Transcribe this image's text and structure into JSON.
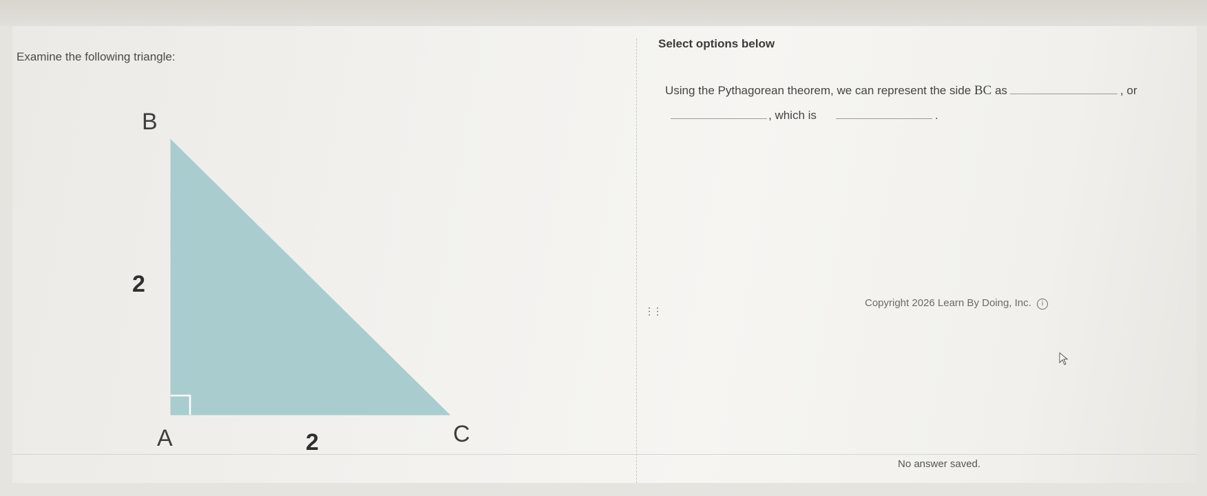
{
  "left_panel": {
    "prompt": "Examine the following triangle:",
    "triangle": {
      "vertices": [
        "B",
        "A",
        "C"
      ],
      "side_labels": {
        "AB": "2",
        "AC": "2"
      },
      "fill_color": "#a9cdcf",
      "right_angle_at": "A"
    }
  },
  "right_panel": {
    "heading": "Select options below",
    "sentence": {
      "part1": "Using the Pythagorean theorem, we can represent the side ",
      "side_name": "BC",
      "part2": " as",
      "part3": ", or",
      "part4": ", which is",
      "part5": "."
    },
    "copyright": "Copyright 2026 Learn By Doing, Inc.",
    "info_icon": "info-icon",
    "drag_handle_icon": "drag-handle-icon"
  },
  "footer": {
    "status": "No answer saved."
  }
}
